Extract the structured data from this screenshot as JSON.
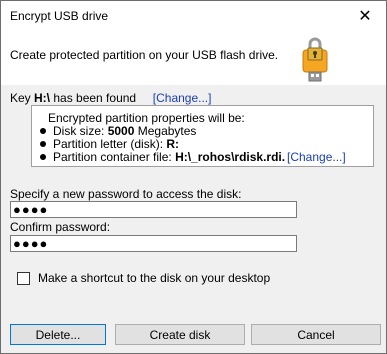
{
  "window": {
    "title": "Encrypt USB drive",
    "close_glyph": "✕"
  },
  "header": {
    "text": "Create protected partition on your USB flash drive.",
    "icon": "usb-lock-icon"
  },
  "key": {
    "prefix": "Key ",
    "drive": "H:\\",
    "suffix": " has been found",
    "change_label": "[Change...]"
  },
  "properties": {
    "title": "Encrypted partition properties will be:",
    "disk_size_label": "Disk size: ",
    "disk_size_value": "5000",
    "disk_size_unit": " Megabytes",
    "letter_label": "Partition letter (disk): ",
    "letter_value": "R:",
    "container_label": "Partition container file: ",
    "container_value": "H:\\_rohos\\rdisk.rdi.",
    "change_label": "[Change...]"
  },
  "password": {
    "new_label": "Specify a new password to access the disk:",
    "new_value": "●●●●",
    "confirm_label": "Confirm password:",
    "confirm_value": "●●●●"
  },
  "shortcut": {
    "label": "Make a shortcut to the disk on your desktop",
    "checked": false
  },
  "buttons": {
    "delete": "Delete...",
    "create": "Create disk",
    "cancel": "Cancel"
  },
  "colors": {
    "link": "#1a3fb5",
    "accent": "#0078d7",
    "usb_body": "#f5a623"
  }
}
